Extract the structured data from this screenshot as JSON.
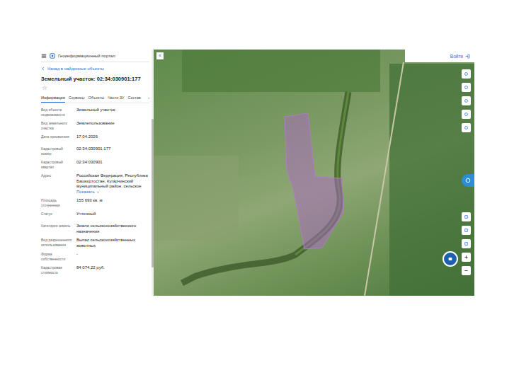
{
  "window": {
    "title": "Геоинформационный портал"
  },
  "panel": {
    "back": "Назад в найденные объекты",
    "title": "Земельный участок: 02:34:030901:177",
    "star": "☆",
    "tabs": [
      {
        "label": "Информация",
        "selected": true
      },
      {
        "label": "Сервисы",
        "selected": false
      },
      {
        "label": "Объекты",
        "selected": false
      },
      {
        "label": "Части ЗУ",
        "selected": false
      },
      {
        "label": "Состав",
        "selected": false
      }
    ],
    "tabs_more": "›",
    "rows": [
      {
        "label": "Вид объекта недвижимости",
        "value": "Земельный участок"
      },
      {
        "label": "Вид земельного участка",
        "value": "Землепользование"
      },
      {
        "label": "Дата присвоения",
        "value": "17.04.2026"
      },
      {
        "label": "Кадастровый номер",
        "value": "02:34:030901:177"
      },
      {
        "label": "Кадастровый квартал",
        "value": "02:34:030901"
      },
      {
        "label": "Адрес",
        "value": "Российская Федерация, Республика Башкортостан, Кугарчинский муниципальный район, сельское",
        "link": "Показать"
      },
      {
        "label": "Площадь уточненная",
        "value": "155 693 кв. м"
      },
      {
        "label": "Статус",
        "value": "Учтенный"
      },
      {
        "label": "Категория земель",
        "value": "Земли сельскохозяйственного назначения"
      },
      {
        "label": "Вид разрешенного использования",
        "value": "Выпас сельскохозяйственных животных"
      },
      {
        "label": "Форма собственности",
        "value": "-"
      },
      {
        "label": "Кадастровая стоимость",
        "value": "84 074,22 руб."
      }
    ]
  },
  "map": {
    "collapse": "«",
    "login": "Войти"
  }
}
